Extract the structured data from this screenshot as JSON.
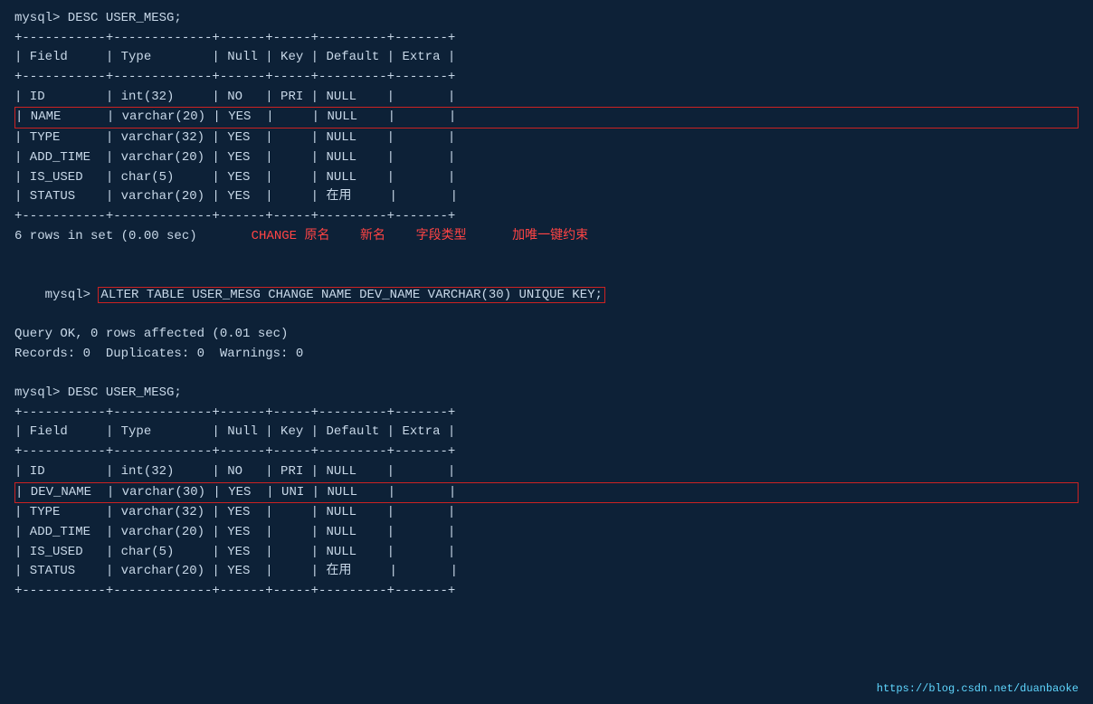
{
  "terminal": {
    "bg_color": "#0d2137",
    "text_color": "#c8d8e8"
  },
  "block1": {
    "command": "mysql> DESC USER_MESG;",
    "separator": "+-----------+-------------+------+-----+---------+-------+",
    "header": "| Field     | Type        | Null | Key | Default | Extra |",
    "rows": [
      {
        "content": "| ID        | int(32)     | NO   | PRI | NULL    |       |",
        "highlight": false
      },
      {
        "content": "| NAME      | varchar(20) | YES  |     | NULL    |       |",
        "highlight": true
      },
      {
        "content": "| TYPE      | varchar(32) | YES  |     | NULL    |       |",
        "highlight": false
      },
      {
        "content": "| ADD_TIME  | varchar(20) | YES  |     | NULL    |       |",
        "highlight": false
      },
      {
        "content": "| IS_USED   | char(5)     | YES  |     | NULL    |       |",
        "highlight": false
      },
      {
        "content": "| STATUS    | varchar(20) | YES  |     | 在用     |       |",
        "highlight": false
      }
    ],
    "rowcount": "6 rows in set (0.00 sec)",
    "annotation": "CHANGE 原名    新名    字段类型      加唯一键约束"
  },
  "block2": {
    "command_prefix": "mysql> ",
    "command_body": "ALTER TABLE USER_MESG CHANGE NAME DEV_NAME VARCHAR(30) UNIQUE KEY;",
    "line2": "Query OK, 0 rows affected (0.01 sec)",
    "line3": "Records: 0  Duplicates: 0  Warnings: 0"
  },
  "block3": {
    "command": "mysql> DESC USER_MESG;",
    "separator": "+-----------+-------------+------+-----+---------+-------+",
    "header": "| Field     | Type        | Null | Key | Default | Extra |",
    "rows": [
      {
        "content": "| ID        | int(32)     | NO   | PRI | NULL    |       |",
        "highlight": false
      },
      {
        "content": "| DEV_NAME  | varchar(30) | YES  | UNI | NULL    |       |",
        "highlight": true
      },
      {
        "content": "| TYPE      | varchar(32) | YES  |     | NULL    |       |",
        "highlight": false
      },
      {
        "content": "| ADD_TIME  | varchar(20) | YES  |     | NULL    |       |",
        "highlight": false
      },
      {
        "content": "| IS_USED   | char(5)     | YES  |     | NULL    |       |",
        "highlight": false
      },
      {
        "content": "| STATUS    | varchar(20) | YES  |     | 在用     |       |",
        "highlight": false
      }
    ]
  },
  "watermark": "https://blog.csdn.net/duanbaoke"
}
